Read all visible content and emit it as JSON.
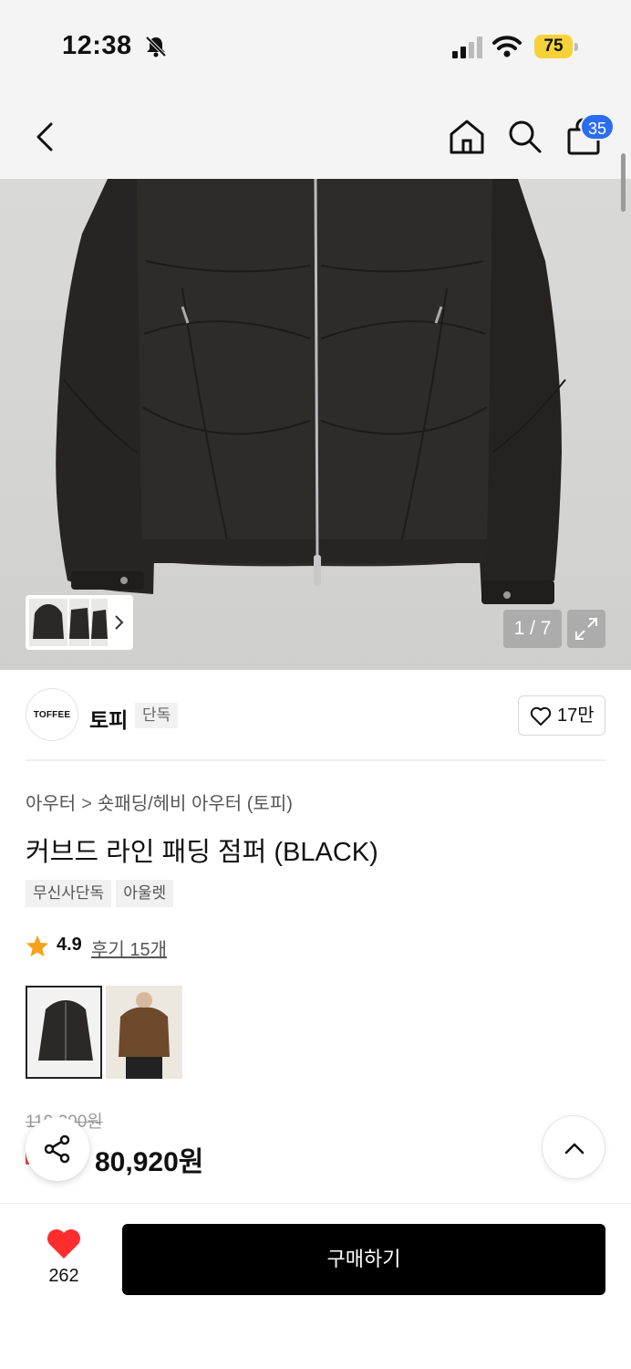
{
  "status_bar": {
    "time": "12:38",
    "battery": "75",
    "icons": [
      "bell-muted-icon",
      "signal-icon",
      "wifi-icon",
      "battery-icon"
    ]
  },
  "header": {
    "icons": [
      "back-icon",
      "home-icon",
      "search-icon",
      "shopping-bag-icon"
    ],
    "cart_count": "35"
  },
  "gallery": {
    "page_indicator": "1 / 7",
    "icons": [
      "chevron-right-icon",
      "expand-icon"
    ]
  },
  "brand": {
    "logo_text": "TOFFEE",
    "name": "토피",
    "tag": "단독",
    "like_count": "17만"
  },
  "product": {
    "breadcrumb": [
      "아우터",
      "숏패딩/헤비 아우터 (토피)"
    ],
    "title": "커브드 라인 패딩 점퍼 (BLACK)",
    "tags": [
      "무신사단독",
      "아울렛"
    ],
    "rating": "4.9",
    "reviews": "후기 15개",
    "original_price": "119,000원",
    "sale_price": "80,920원"
  },
  "bottom_bar": {
    "wish_count": "262",
    "buy_label": "구매하기"
  },
  "colors": {
    "accent_blue": "#2b6df0",
    "heart_red": "#ff2d2d",
    "star_orange": "#f7a21b",
    "buy_button": "#000000"
  }
}
